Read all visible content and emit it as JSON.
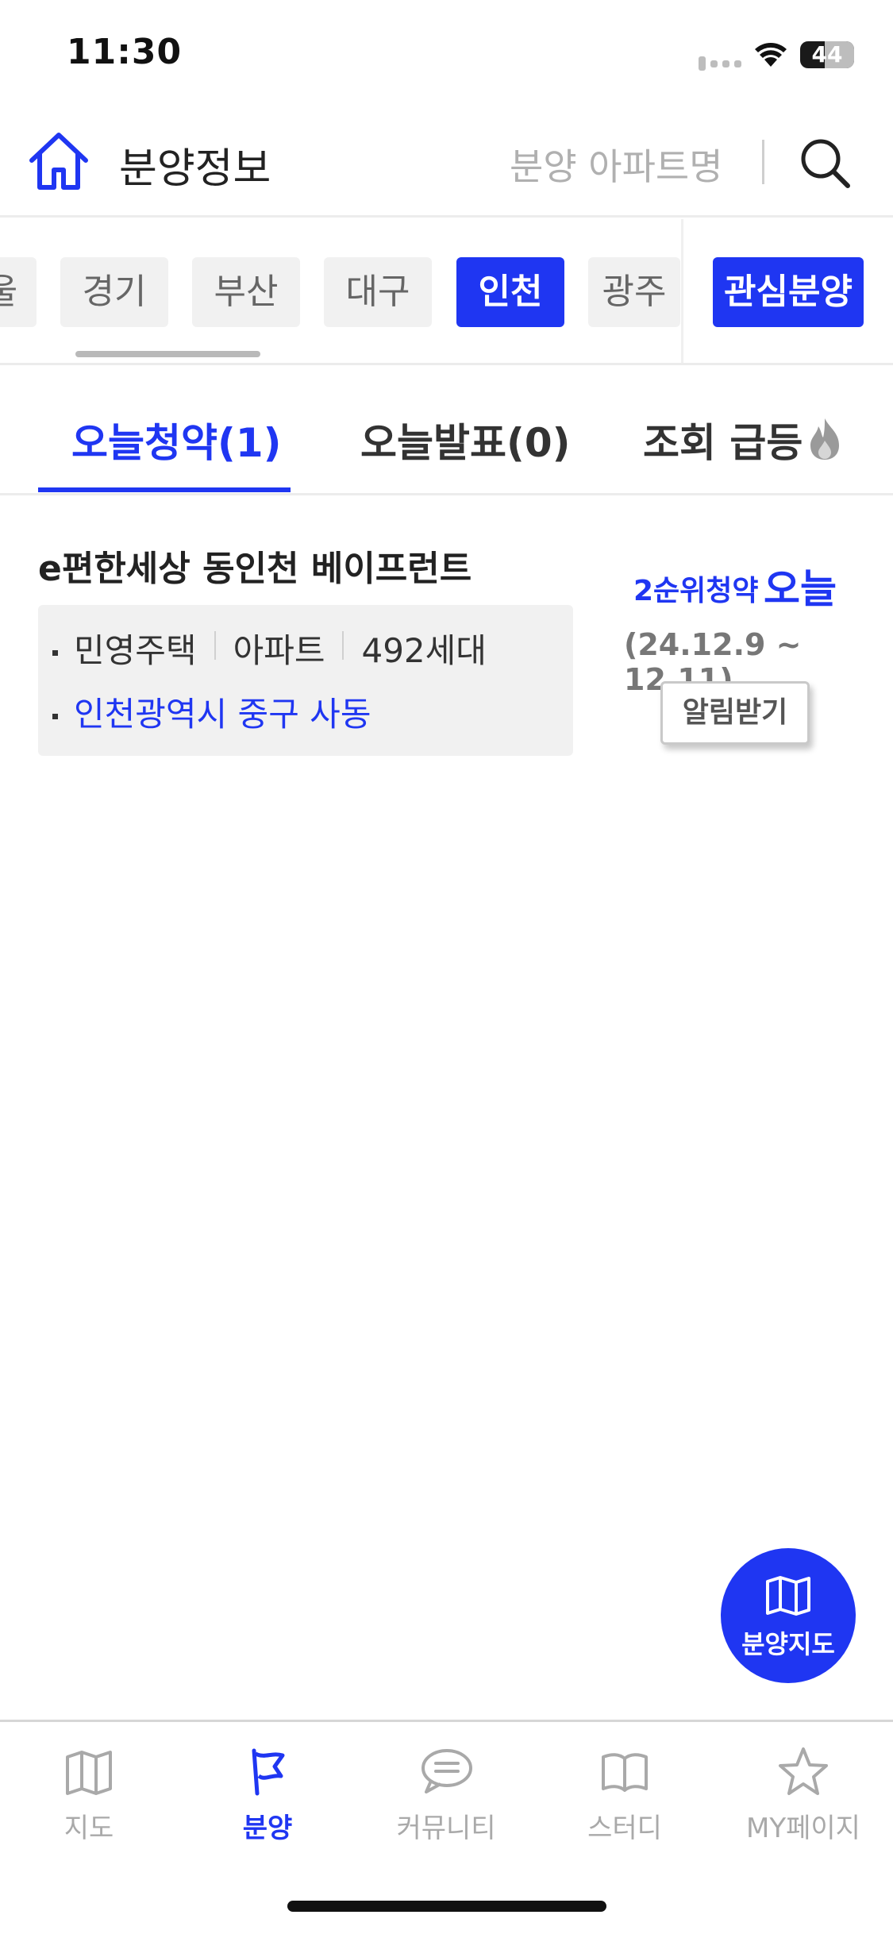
{
  "status_bar": {
    "time": "11:30",
    "battery": "44"
  },
  "header": {
    "title": "분양정보",
    "search_placeholder": "분양 아파트명",
    "home_icon": "home-icon",
    "search_icon": "search-icon"
  },
  "regions": {
    "items": [
      {
        "label": "울"
      },
      {
        "label": "경기"
      },
      {
        "label": "부산"
      },
      {
        "label": "대구"
      },
      {
        "label": "인천",
        "active": true
      },
      {
        "label": "광주"
      }
    ],
    "favorite_label": "관심분양"
  },
  "tabs": [
    {
      "label": "오늘청약(1)",
      "active": true
    },
    {
      "label": "오늘발표(0)"
    },
    {
      "label": "조회 급등",
      "icon": "fire-icon"
    }
  ],
  "listing": {
    "title": "e편한세상 동인천 베이프런트",
    "housing_type": "민영주택",
    "building_type": "아파트",
    "units": "492세대",
    "address": "인천광역시 중구 사동",
    "subscription_type": "2순위청약",
    "subscription_day": "오늘",
    "period": "(24.12.9 ~ 12.11)",
    "alert_button": "알림받기"
  },
  "fab": {
    "label": "분양지도",
    "icon": "map-icon"
  },
  "bottom_nav": [
    {
      "label": "지도",
      "icon": "map-icon"
    },
    {
      "label": "분양",
      "icon": "flag-icon",
      "active": true
    },
    {
      "label": "커뮤니티",
      "icon": "chat-icon"
    },
    {
      "label": "스터디",
      "icon": "book-icon"
    },
    {
      "label": "MY페이지",
      "icon": "star-icon"
    }
  ],
  "colors": {
    "accent": "#1f36f2",
    "chip_bg": "#f1f1f1",
    "muted": "#a9a9a9"
  }
}
